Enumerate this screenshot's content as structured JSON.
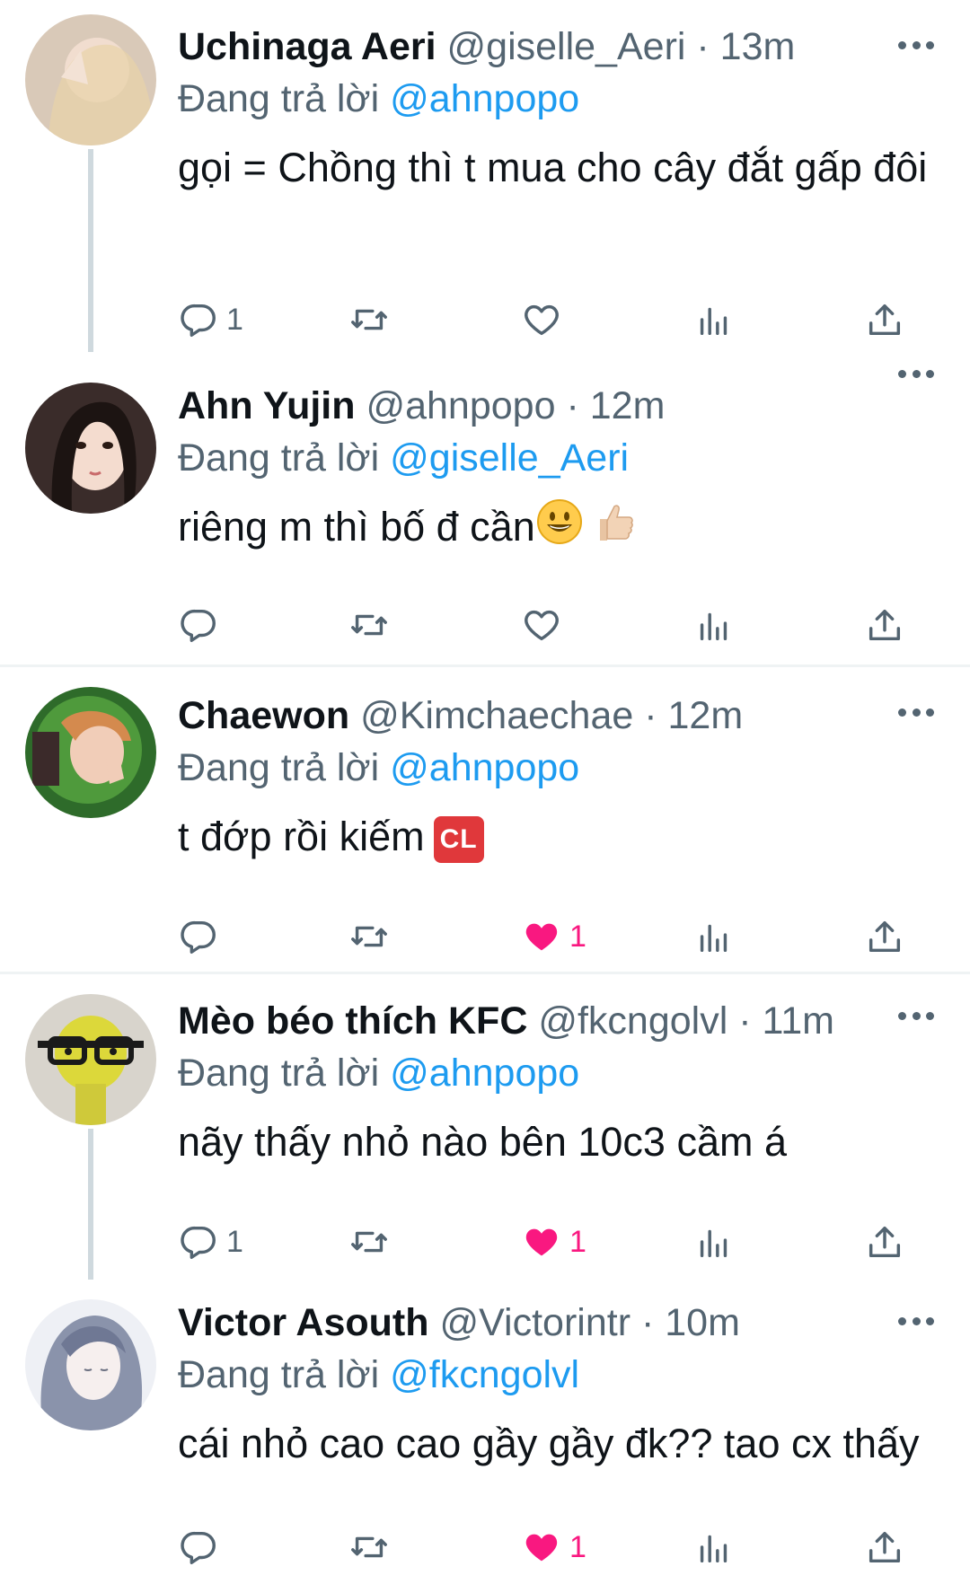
{
  "tweets": [
    {
      "name": "Uchinaga Aeri",
      "handle": "@giselle_Aeri",
      "time": "13m",
      "replying_label": "Đang trả lời",
      "replying_to": "@ahnpopo",
      "text": "gọi = Chồng thì t mua cho cây đắt gấp đôi",
      "reply_count": "1",
      "like_count": "",
      "liked": false
    },
    {
      "name": "Ahn Yujin",
      "handle": "@ahnpopo",
      "time": "12m",
      "replying_label": "Đang trả lời",
      "replying_to": "@giselle_Aeri",
      "text": "riêng m thì bố đ cần",
      "emojis": [
        "grinning-face-emoji",
        "thumbs-up-emoji"
      ],
      "reply_count": "",
      "like_count": "",
      "liked": false
    },
    {
      "name": "Chaewon",
      "handle": "@Kimchaechae",
      "time": "12m",
      "replying_label": "Đang trả lời",
      "replying_to": "@ahnpopo",
      "text": "t đớp rồi kiếm",
      "badge": "CL",
      "reply_count": "",
      "like_count": "1",
      "liked": true
    },
    {
      "name": "Mèo béo thích KFC",
      "handle": "@fkcngolvl",
      "time": "11m",
      "replying_label": "Đang trả lời",
      "replying_to": "@ahnpopo",
      "text": "nãy thấy nhỏ nào bên 10c3 cầm á",
      "reply_count": "1",
      "like_count": "1",
      "liked": true
    },
    {
      "name": "Victor Asouth",
      "handle": "@Victorintr",
      "time": "10m",
      "replying_label": "Đang trả lời",
      "replying_to": "@fkcngolvl",
      "text": "cái nhỏ cao cao gầy gầy đk?? tao cx thấy",
      "reply_count": "",
      "like_count": "1",
      "liked": true
    }
  ],
  "colors": {
    "link": "#1d9bf0",
    "muted": "#536471",
    "like": "#f91880",
    "divider": "#eff3f4",
    "thread": "#cfd9de"
  },
  "icons": [
    "reply-icon",
    "retweet-icon",
    "like-icon",
    "views-icon",
    "share-icon",
    "more-icon"
  ]
}
